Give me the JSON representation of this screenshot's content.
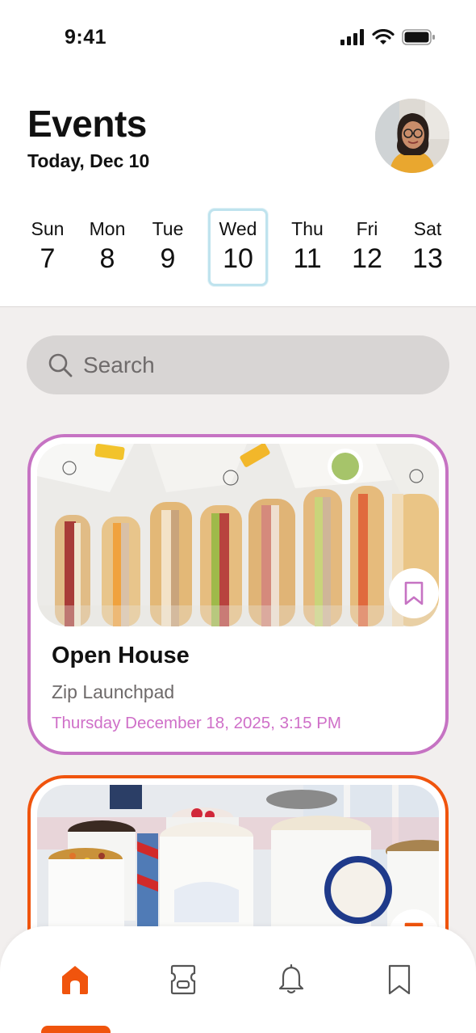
{
  "status_bar": {
    "time": "9:41"
  },
  "header": {
    "title": "Events",
    "subtitle": "Today, Dec 10"
  },
  "week": [
    {
      "name": "Sun",
      "num": "7"
    },
    {
      "name": "Mon",
      "num": "8"
    },
    {
      "name": "Tue",
      "num": "9"
    },
    {
      "name": "Wed",
      "num": "10",
      "selected": true
    },
    {
      "name": "Thu",
      "num": "11"
    },
    {
      "name": "Fri",
      "num": "12"
    },
    {
      "name": "Sat",
      "num": "13"
    }
  ],
  "search": {
    "placeholder": "Search"
  },
  "events": [
    {
      "title": "Open House",
      "location": "Zip Launchpad",
      "datetime": "Thursday December 18, 2025, 3:15 PM",
      "border_color": "#c673c3"
    },
    {
      "border_color": "#f0540d"
    }
  ],
  "tab_bar": {
    "tabs": [
      "home-icon",
      "ticket-icon",
      "bell-icon",
      "bookmark-icon"
    ],
    "active_color": "#f0540d"
  }
}
